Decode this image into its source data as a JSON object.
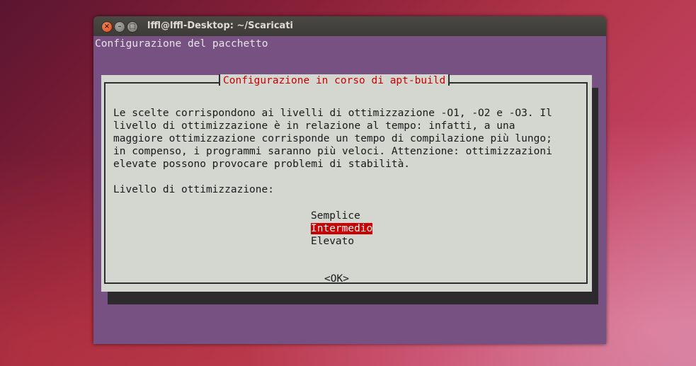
{
  "window": {
    "title": "lffl@lffl-Desktop: ~/Scaricati",
    "close_glyph": "×",
    "minimize_glyph": "–",
    "maximize_glyph": "□"
  },
  "terminal": {
    "backtitle": "Configurazione del pacchetto",
    "dialog": {
      "title": "Configurazione in corso di apt-build",
      "message": "Le scelte corrispondono ai livelli di ottimizzazione -O1, -O2 e -O3. Il\nlivello di ottimizzazione è in relazione al tempo: infatti, a una\nmaggiore ottimizzazione corrisponde un tempo di compilazione più lungo;\nin compenso, i programmi saranno più veloci. Attenzione: ottimizzazioni\nelevate possono provocare problemi di stabilità.",
      "prompt": "Livello di ottimizzazione:",
      "options": [
        "Semplice",
        "Intermedio",
        "Elevato"
      ],
      "selected_option": "Intermedio",
      "ok_label": "<OK>"
    }
  },
  "colors": {
    "terminal_bg": "#775182",
    "dialog_bg": "#d3d7cf",
    "accent_red": "#cc0000"
  }
}
